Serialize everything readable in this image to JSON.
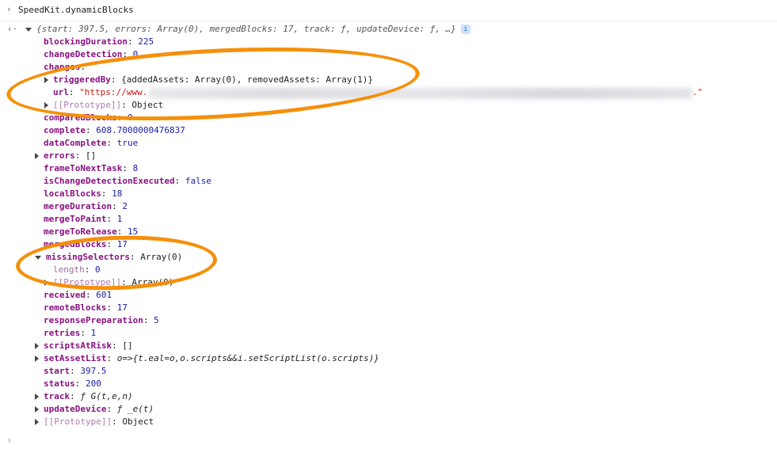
{
  "command": {
    "prompt_glyph": "›",
    "text": "SpeedKit.dynamicBlocks"
  },
  "result": {
    "arrow_glyph": "‹·",
    "summary": "{start: 397.5, errors: Array(0), mergedBlocks: 17, track: ƒ, updateDevice: ƒ, …}",
    "info_badge": "i"
  },
  "properties": [
    {
      "key": "blockingDuration",
      "sep": ": ",
      "value": "225",
      "type": "number"
    },
    {
      "key": "changeDetection",
      "sep": ": ",
      "value": "0",
      "type": "number"
    },
    {
      "key": "changes",
      "sep": ":",
      "value": "",
      "type": "open"
    },
    {
      "key": "triggeredBy",
      "sep": ": ",
      "value": "{addedAssets: Array(0), removedAssets: Array(1)}",
      "type": "plain",
      "expander": "closed",
      "level": 2
    },
    {
      "key": "url",
      "sep": ": ",
      "value": "\"https://www.",
      "tail": ".\"",
      "type": "string",
      "level": 2
    },
    {
      "key": "[[Prototype]]",
      "sep": ": ",
      "value": "Object",
      "type": "proto",
      "expander": "closed",
      "level": 2
    },
    {
      "key": "comparedBlocks",
      "sep": ": ",
      "value": "0",
      "type": "number"
    },
    {
      "key": "complete",
      "sep": ": ",
      "value": "608.7000000476837",
      "type": "number"
    },
    {
      "key": "dataComplete",
      "sep": ": ",
      "value": "true",
      "type": "bool"
    },
    {
      "key": "errors",
      "sep": ": ",
      "value": "[]",
      "type": "plain",
      "expander": "closed"
    },
    {
      "key": "frameToNextTask",
      "sep": ": ",
      "value": "8",
      "type": "number"
    },
    {
      "key": "isChangeDetectionExecuted",
      "sep": ": ",
      "value": "false",
      "type": "bool"
    },
    {
      "key": "localBlocks",
      "sep": ": ",
      "value": "18",
      "type": "number"
    },
    {
      "key": "mergeDuration",
      "sep": ": ",
      "value": "2",
      "type": "number"
    },
    {
      "key": "mergeToPaint",
      "sep": ": ",
      "value": "1",
      "type": "number"
    },
    {
      "key": "mergeToRelease",
      "sep": ": ",
      "value": "15",
      "type": "number"
    },
    {
      "key": "mergedBlocks",
      "sep": ": ",
      "value": "17",
      "type": "number"
    },
    {
      "key": "missingSelectors",
      "sep": ": ",
      "value": "Array(0)",
      "type": "plain",
      "expander": "open"
    },
    {
      "key": "length",
      "sep": ": ",
      "value": "0",
      "type": "number",
      "level": 2,
      "dim": true
    },
    {
      "key": "[[Prototype]]",
      "sep": ": ",
      "value": "Array(0)",
      "type": "proto",
      "expander": "closed",
      "level": 2
    },
    {
      "key": "received",
      "sep": ": ",
      "value": "601",
      "type": "number"
    },
    {
      "key": "remoteBlocks",
      "sep": ": ",
      "value": "17",
      "type": "number"
    },
    {
      "key": "responsePreparation",
      "sep": ": ",
      "value": "5",
      "type": "number"
    },
    {
      "key": "retries",
      "sep": ": ",
      "value": "1",
      "type": "number"
    },
    {
      "key": "scriptsAtRisk",
      "sep": ": ",
      "value": "[]",
      "type": "plain",
      "expander": "closed"
    },
    {
      "key": "setAssetList",
      "sep": ": ",
      "value": "o=>{t.eal=o,o.scripts&&i.setScriptList(o.scripts)}",
      "type": "func",
      "expander": "closed"
    },
    {
      "key": "start",
      "sep": ": ",
      "value": "397.5",
      "type": "number"
    },
    {
      "key": "status",
      "sep": ": ",
      "value": "200",
      "type": "number"
    },
    {
      "key": "track",
      "sep": ": ",
      "value": "ƒ G(t,e,n)",
      "type": "func",
      "expander": "closed"
    },
    {
      "key": "updateDevice",
      "sep": ": ",
      "value": "ƒ _e(t)",
      "type": "func",
      "expander": "closed"
    },
    {
      "key": "[[Prototype]]",
      "sep": ": ",
      "value": "Object",
      "type": "proto",
      "expander": "closed"
    }
  ],
  "input_prompt": "›",
  "colors": {
    "annotation": "#f5900a",
    "key": "#881280",
    "number": "#1a1aa6",
    "string": "#c41a16"
  }
}
